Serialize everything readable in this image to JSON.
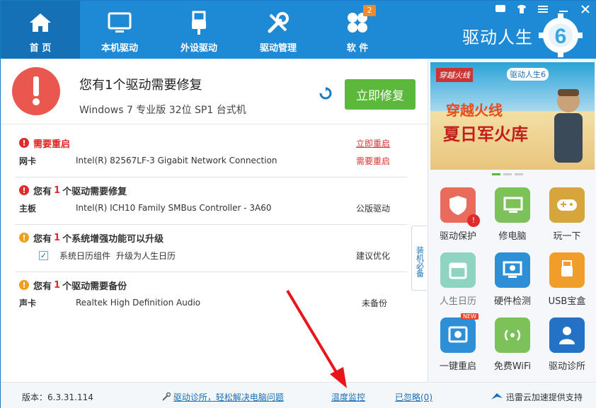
{
  "nav": [
    {
      "label": "首 页",
      "icon": "home-icon"
    },
    {
      "label": "本机驱动",
      "icon": "monitor-icon"
    },
    {
      "label": "外设驱动",
      "icon": "usb-icon"
    },
    {
      "label": "驱动管理",
      "icon": "tools-icon"
    },
    {
      "label": "软 件",
      "icon": "apps-icon",
      "badge": "2"
    }
  ],
  "brand": {
    "name": "驱动人生",
    "version_mark": "6"
  },
  "status": {
    "headline": "您有1个驱动需要修复",
    "system": "Windows 7 专业版  32位 SP1 台式机",
    "fix_button": "立即修复"
  },
  "sections": [
    {
      "title": "需要重启",
      "action": "立即重启",
      "rows": [
        {
          "k": "网卡",
          "v": "Intel(R) 82567LF-3 Gigabit Network Connection",
          "s": "需要重启"
        }
      ]
    },
    {
      "title_pre": "您有",
      "count": "1",
      "title_post": "个驱动需要修复",
      "rows": [
        {
          "k": "主板",
          "v": "Intel(R) ICH10 Family SMBus Controller - 3A60",
          "s": "公版驱动"
        }
      ]
    },
    {
      "title_pre": "您有",
      "count": "1",
      "title_post": "个系统增强功能可以升级",
      "rows": [
        {
          "k": "系统日历组件",
          "v": "升级为人生日历",
          "s": "建议优化"
        }
      ]
    },
    {
      "title_pre": "您有",
      "count": "1",
      "title_post": "个驱动需要备份",
      "rows": [
        {
          "k": "声卡",
          "v": "Realtek High Definition Audio",
          "s": "未备份"
        }
      ]
    }
  ],
  "side_tab": "装机必备",
  "banner": {
    "tag": "穿越火线",
    "logo": "驱动人生6",
    "line1": "穿越火线",
    "line2": "夏日军火库"
  },
  "tiles": [
    {
      "label": "驱动保护"
    },
    {
      "label": "修电脑"
    },
    {
      "label": "玩一下"
    },
    {
      "label": "人生日历"
    },
    {
      "label": "硬件检测"
    },
    {
      "label": "USB宝盒"
    },
    {
      "label": "一键重启",
      "new": "NEW"
    },
    {
      "label": "免费WiFi"
    },
    {
      "label": "驱动诊所"
    }
  ],
  "footer": {
    "version": "版本：6.3.31.114",
    "clinic": "驱动诊所，轻松解决电脑问题",
    "temp": "温度监控",
    "ignored": "已忽略(0)",
    "cloud": "迅雷云加速提供支持"
  },
  "colors": {
    "header": "#1e8ad6",
    "active": "#1570b5",
    "fix": "#5cb83b",
    "alert": "#e9574f"
  }
}
